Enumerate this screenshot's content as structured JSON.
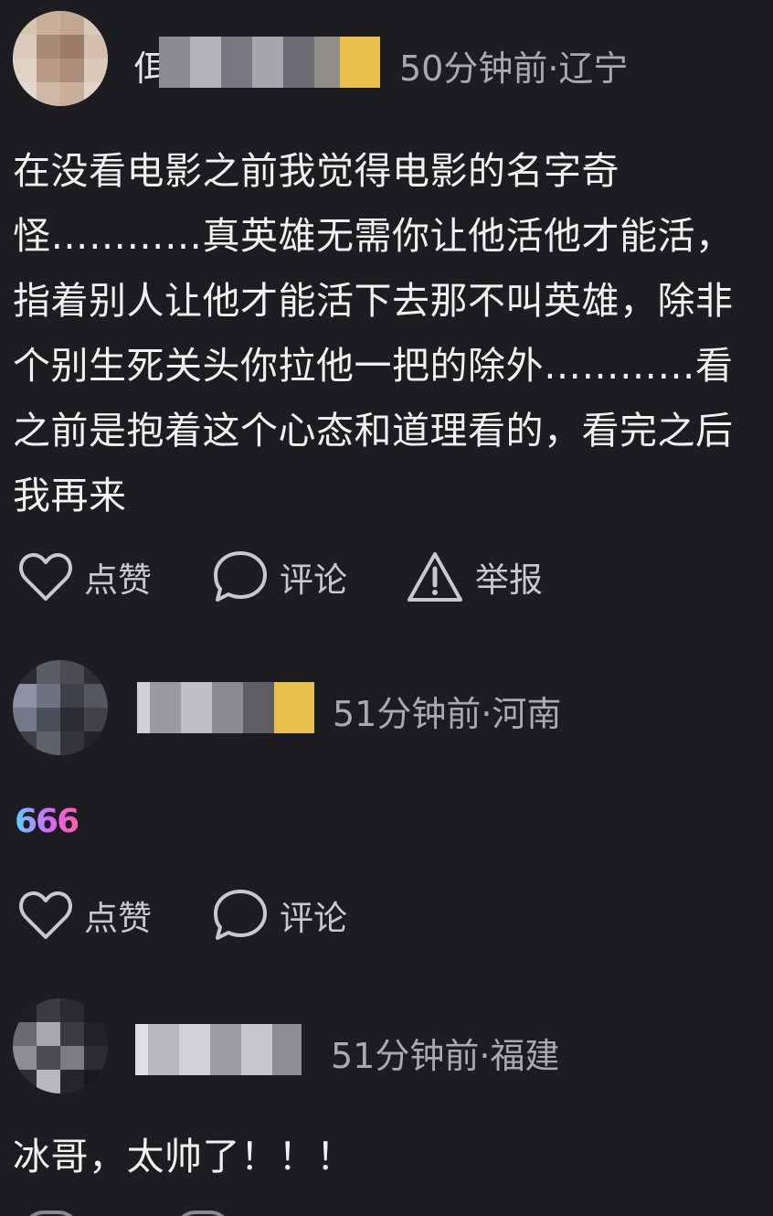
{
  "comments": [
    {
      "meta": "50分钟前·辽宁",
      "name_fragment": "佴",
      "text": "在没看电影之前我觉得电影的名字奇怪…………真英雄无需你让他活他才能活，指着别人让他才能活下去那不叫英雄，除非个别生死关头你拉他一把的除外…………看之前是抱着这个心态和道理看的，看完之后我再来",
      "actions": {
        "like": "点赞",
        "reply": "评论",
        "report": "举报"
      }
    },
    {
      "meta": "51分钟前·河南",
      "text": "666",
      "actions": {
        "like": "点赞",
        "reply": "评论"
      }
    },
    {
      "meta": "51分钟前·福建",
      "text": "冰哥，太帅了！！！"
    }
  ],
  "icons": {
    "like": "heart-icon",
    "reply": "speech-bubble-icon",
    "report": "warning-triangle-icon"
  },
  "colors": {
    "background": "#1c1c21",
    "text": "#f1f1f1",
    "meta": "#a9a9ae",
    "action": "#c9c9cc",
    "vip_badge": "#e8c04a"
  }
}
